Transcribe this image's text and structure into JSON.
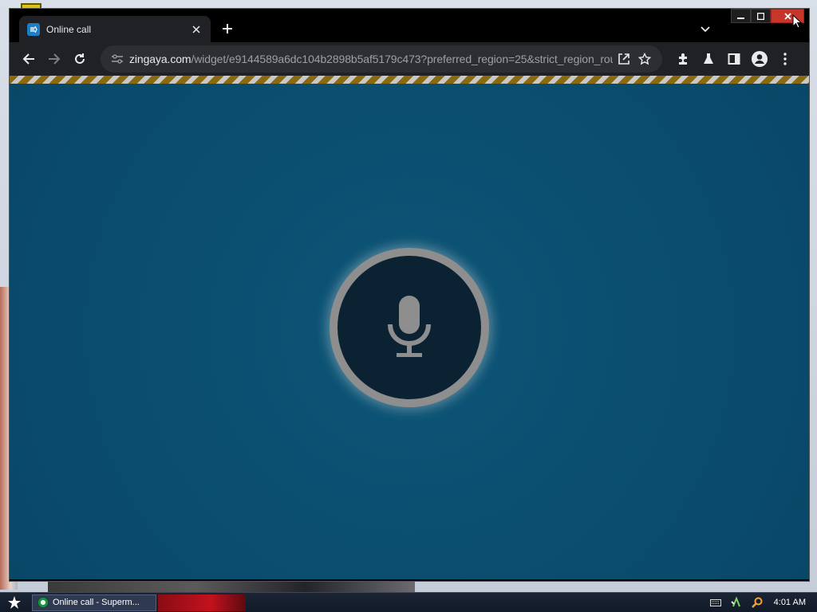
{
  "browser": {
    "tab": {
      "title": "Online call",
      "favicon": "zingaya-icon"
    },
    "url": {
      "host": "zingaya.com",
      "path": "/widget/e9144589a6dc104b2898b5af5179c473?preferred_region=25&strict_region_rou..."
    },
    "toolbar_icons": [
      "back-icon",
      "forward-icon",
      "reload-icon",
      "site-settings-icon",
      "share-icon",
      "star-icon",
      "extensions-icon",
      "labs-icon",
      "side-panel-icon",
      "profile-icon",
      "menu-icon"
    ]
  },
  "widget": {
    "button": "microphone-icon",
    "colors": {
      "background": "#0b4f70",
      "ring": "#8e8e8e",
      "button": "#0b2232"
    }
  },
  "taskbar": {
    "task_label": "Online call - Superm...",
    "clock": "4:01 AM"
  }
}
